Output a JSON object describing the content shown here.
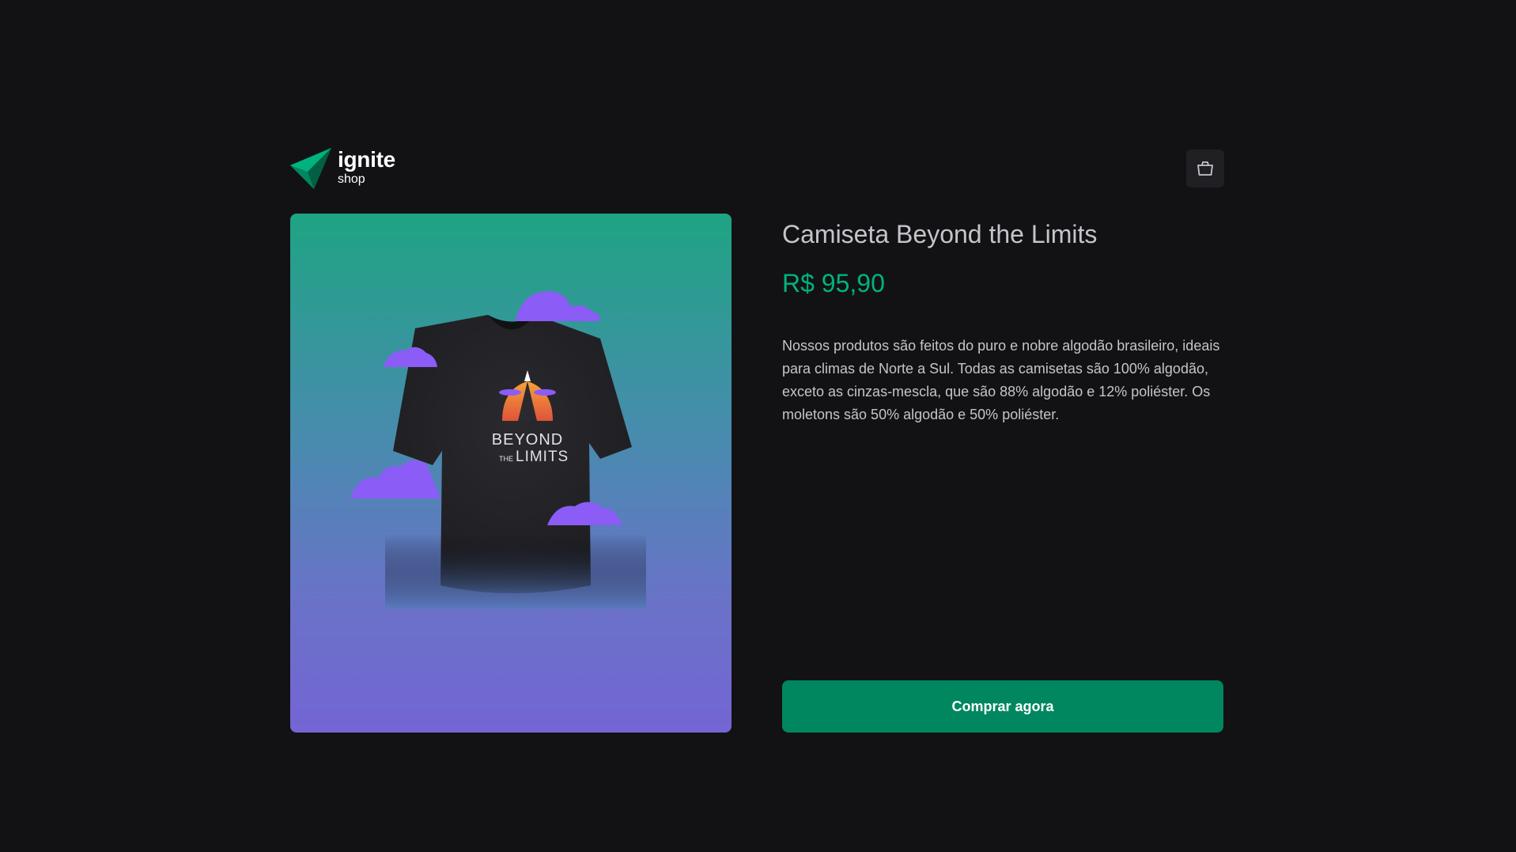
{
  "header": {
    "logo_title": "ignite",
    "logo_subtitle": "shop"
  },
  "icons": {
    "logo": "ignite-logo-icon",
    "cart": "shopping-bag-icon"
  },
  "product": {
    "title": "Camiseta Beyond the Limits",
    "price": "R$ 95,90",
    "description": "Nossos produtos são feitos do puro e nobre algodão brasileiro, ideais para climas de Norte a Sul. Todas as camisetas são 100% algodão, exceto as cinzas-mescla, que são 88% algodão e 12% poliéster. Os moletons são 50% algodão e 50% poliéster.",
    "image_print_line1": "BEYOND",
    "image_print_line2a": "THE",
    "image_print_line2b": "LIMITS",
    "buy_label": "Comprar agora"
  },
  "colors": {
    "background": "#121214",
    "brand_green": "#00875f",
    "price_green": "#00b37e",
    "text": "#c4c4cc"
  }
}
